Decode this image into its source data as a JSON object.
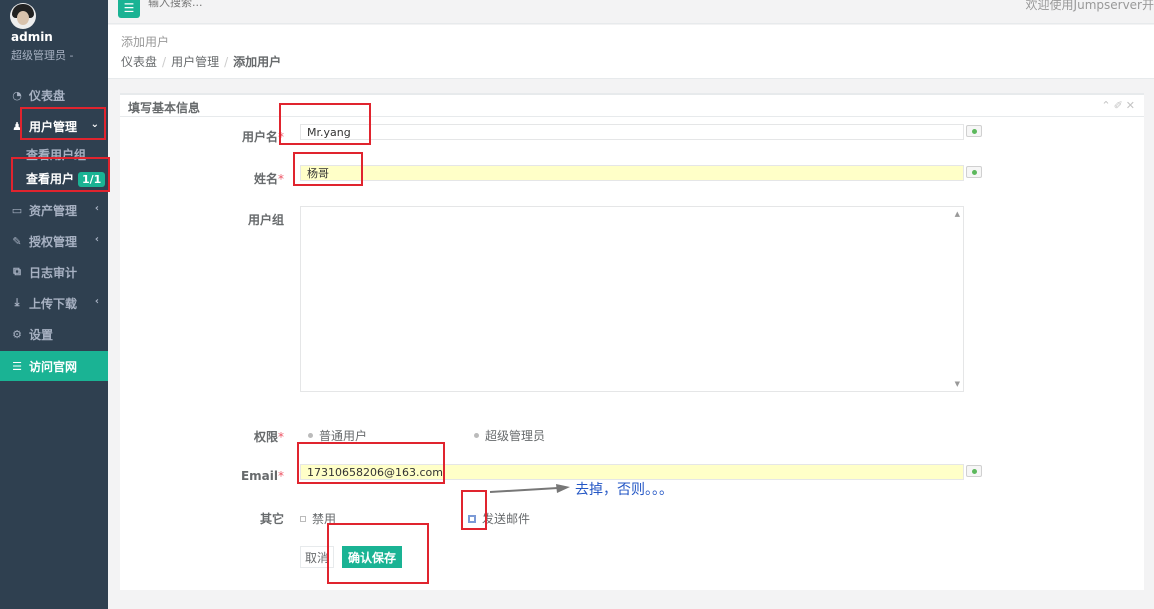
{
  "sidebar": {
    "profile": {
      "name": "admin",
      "role": "超级管理员 -"
    },
    "items": [
      {
        "label": "仪表盘",
        "icon": "dashboard-icon"
      },
      {
        "label": "用户管理",
        "icon": "users-icon"
      },
      {
        "label": "资产管理",
        "icon": "hdd-icon"
      },
      {
        "label": "授权管理",
        "icon": "edit-icon"
      },
      {
        "label": "日志审计",
        "icon": "copy-icon"
      },
      {
        "label": "上传下载",
        "icon": "download-icon"
      },
      {
        "label": "设置",
        "icon": "gears-icon"
      },
      {
        "label": "访问官网",
        "icon": "database-icon"
      }
    ],
    "subitems": [
      {
        "label": "查看用户组"
      },
      {
        "label": "查看用户",
        "badge": "1/1"
      }
    ]
  },
  "topbar": {
    "search_placeholder": "输入搜索...",
    "welcome": "欢迎使用Jumpserver开"
  },
  "heading": {
    "title": "添加用户",
    "breadcrumb": [
      "仪表盘",
      "用户管理",
      "添加用户"
    ]
  },
  "panel": {
    "title": "填写基本信息"
  },
  "form": {
    "username": {
      "label": "用户名",
      "value": "Mr.yang"
    },
    "name": {
      "label": "姓名",
      "value": "杨哥"
    },
    "group": {
      "label": "用户组"
    },
    "role": {
      "label": "权限",
      "options": [
        "普通用户",
        "超级管理员"
      ]
    },
    "email": {
      "label": "Email",
      "value": "17310658206@163.com"
    },
    "other": {
      "label": "其它",
      "options": [
        "禁用",
        "发送邮件"
      ]
    },
    "cancel": "取消",
    "save": "确认保存"
  },
  "annotation": {
    "note": "去掉，否则。。。"
  },
  "colors": {
    "accent": "#1ab394",
    "sidebar": "#2f4050",
    "annotation_red": "#e0242e",
    "annotation_blue": "#2457c5"
  }
}
